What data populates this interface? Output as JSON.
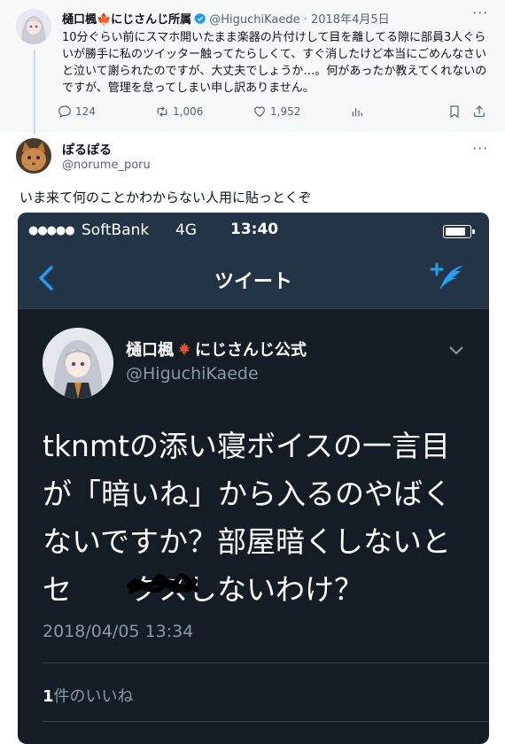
{
  "parent_tweet": {
    "name": "樋口楓🍁にじさんじ所属",
    "handle": "@HiguchiKaede",
    "date": "2018年4月5日",
    "body": "10分ぐらい前にスマホ開いたまま楽器の片付けして目を離してる隙に部員3人ぐらいが勝手に私のツイッター触ってたらしくて、すぐ消したけど本当にごめんなさいと泣いて謝られたのですが、大丈夫でしょうか…。何があったか教えてくれないのですが、管理を怠ってしまい申し訳ありません。",
    "reply_count": "124",
    "retweet_count": "1,006",
    "like_count": "1,952",
    "more": "···"
  },
  "reply": {
    "name": "ぽるぽる",
    "handle": "@norume_poru",
    "text": "いま来て何のことかわからない人用に貼っとくぞ",
    "more": "···"
  },
  "screenshot": {
    "dots": "●●●●●",
    "carrier": "SoftBank",
    "network": "4G",
    "time": "13:40",
    "nav_title": "ツイート",
    "name_part1": "樋口楓",
    "name_part2": "にじさんじ公式",
    "handle": "@HiguchiKaede",
    "tweet_text": "tknmtの添い寝ボイスの一言目が「暗いね」から入るのやばくないですか？部屋暗くしないとセ　　クスしないわけ？",
    "date": "2018/04/05 13:34",
    "likes_count": "1",
    "likes_label": "件のいいね"
  }
}
